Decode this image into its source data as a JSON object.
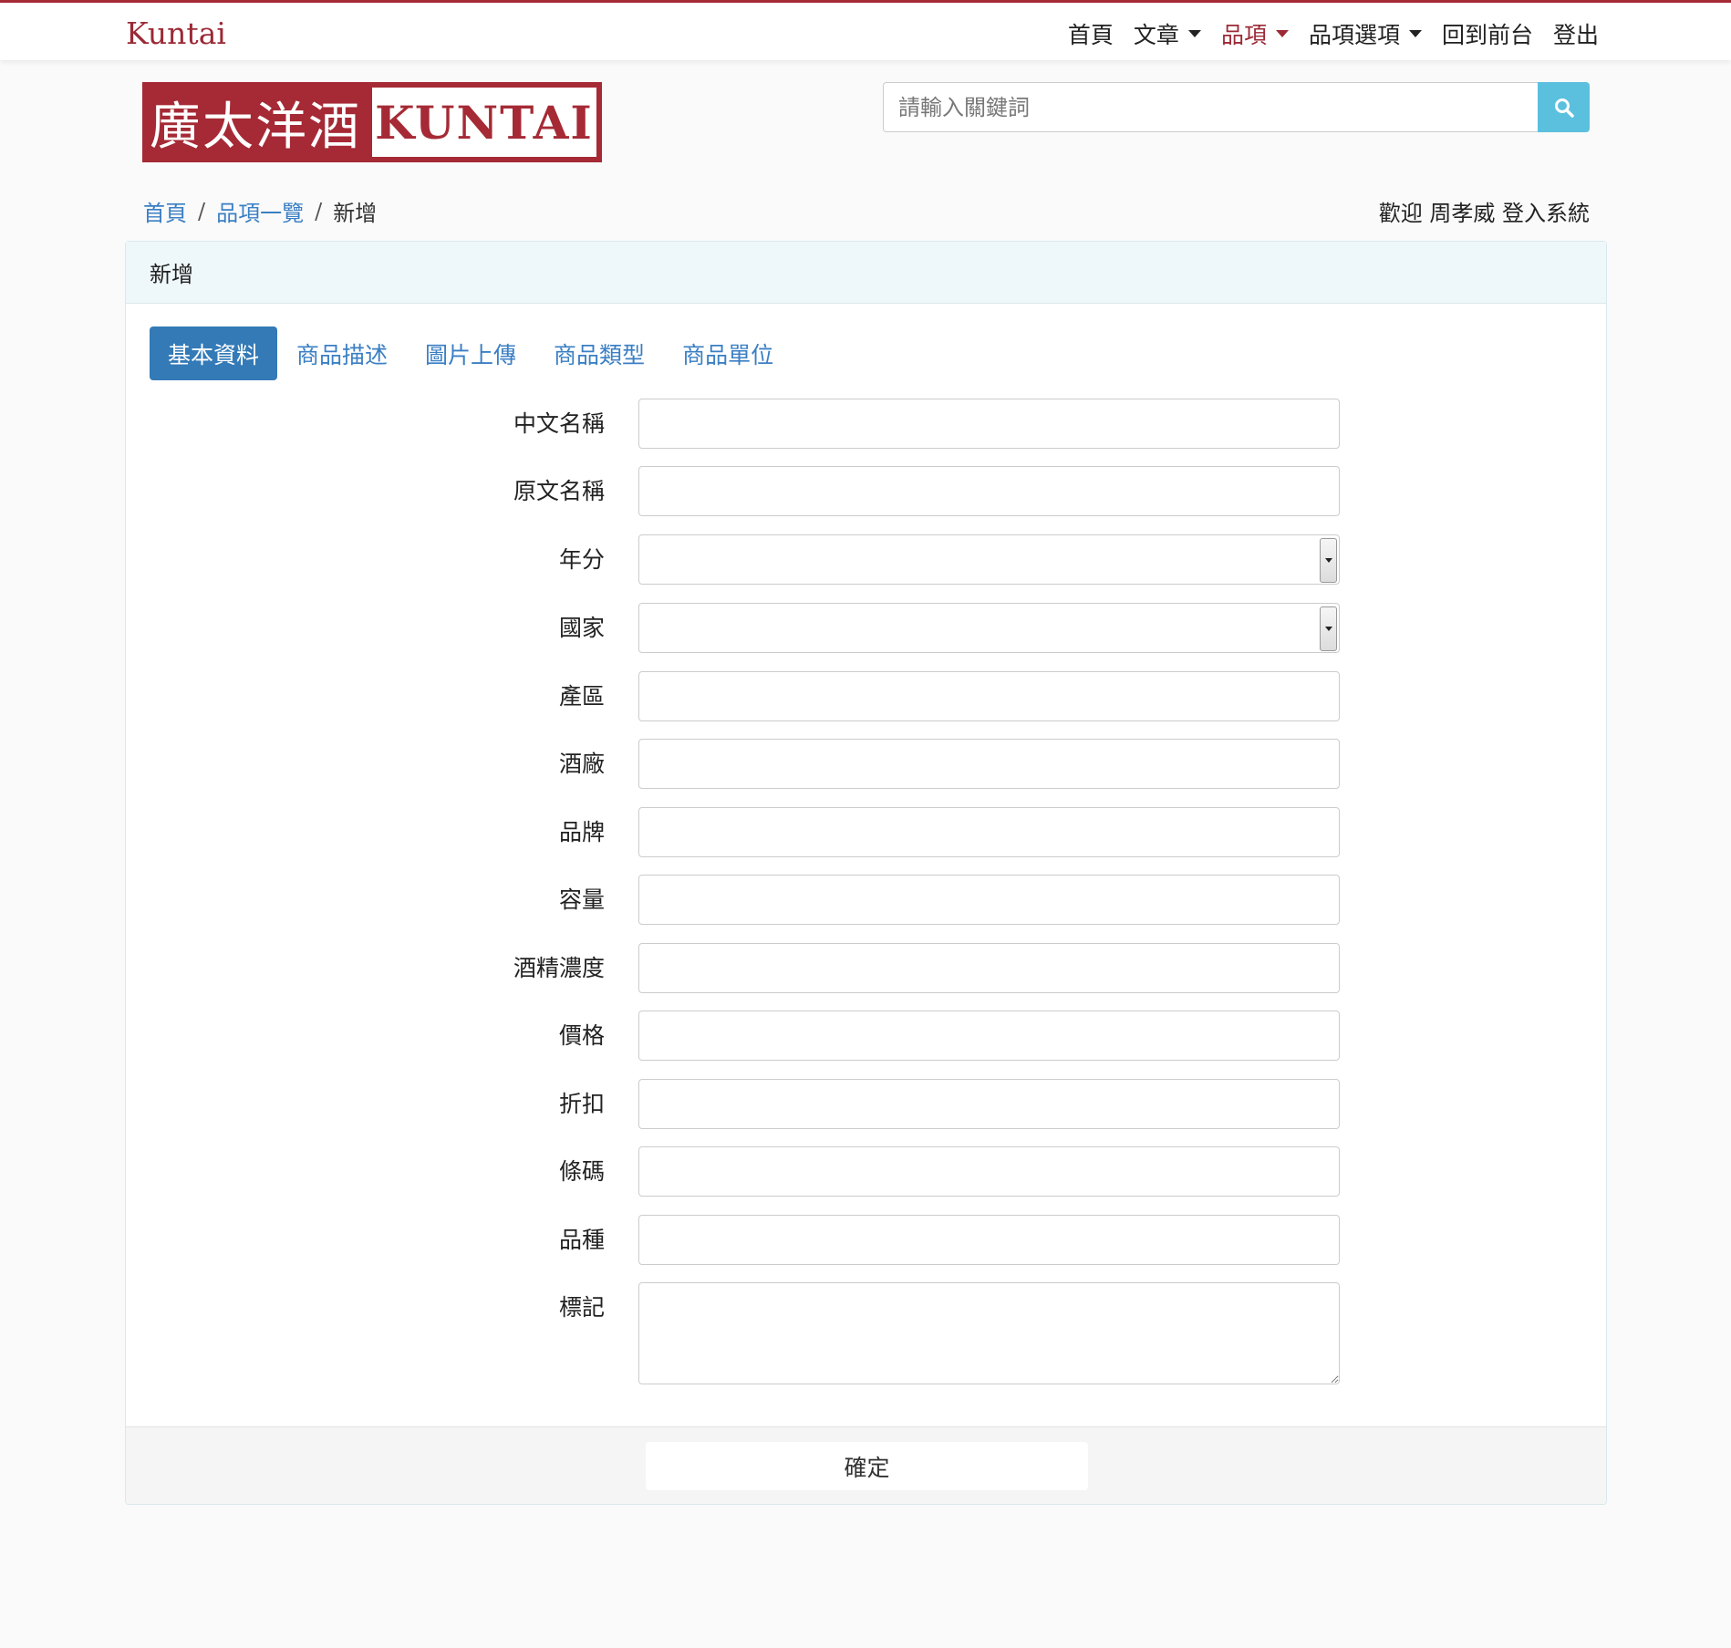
{
  "navbar": {
    "brand": "Kuntai",
    "items": [
      {
        "label": "首頁",
        "dropdown": false,
        "active": false
      },
      {
        "label": "文章",
        "dropdown": true,
        "active": false
      },
      {
        "label": "品項",
        "dropdown": true,
        "active": true
      },
      {
        "label": "品項選項",
        "dropdown": true,
        "active": false
      },
      {
        "label": "回到前台",
        "dropdown": false,
        "active": false
      },
      {
        "label": "登出",
        "dropdown": false,
        "active": false
      }
    ]
  },
  "logo": {
    "cn": "廣太洋酒",
    "en": "KUNTAI"
  },
  "search": {
    "placeholder": "請輸入關鍵詞",
    "icon": "search-icon"
  },
  "breadcrumb": {
    "home": "首頁",
    "list": "品項一覽",
    "separator": "/",
    "current": "新增"
  },
  "welcome": "歡迎 周孝威 登入系統",
  "panel": {
    "heading": "新增",
    "tabs": [
      "基本資料",
      "商品描述",
      "圖片上傳",
      "商品類型",
      "商品單位"
    ],
    "active_tab": 0,
    "fields": [
      {
        "label": "中文名稱",
        "type": "text",
        "value": ""
      },
      {
        "label": "原文名稱",
        "type": "text",
        "value": ""
      },
      {
        "label": "年分",
        "type": "select",
        "value": ""
      },
      {
        "label": "國家",
        "type": "select",
        "value": ""
      },
      {
        "label": "產區",
        "type": "text",
        "value": ""
      },
      {
        "label": "酒廠",
        "type": "text",
        "value": ""
      },
      {
        "label": "品牌",
        "type": "text",
        "value": ""
      },
      {
        "label": "容量",
        "type": "text",
        "value": ""
      },
      {
        "label": "酒精濃度",
        "type": "text",
        "value": ""
      },
      {
        "label": "價格",
        "type": "text",
        "value": ""
      },
      {
        "label": "折扣",
        "type": "text",
        "value": ""
      },
      {
        "label": "條碼",
        "type": "text",
        "value": ""
      },
      {
        "label": "品種",
        "type": "text",
        "value": ""
      },
      {
        "label": "標記",
        "type": "textarea",
        "value": ""
      }
    ],
    "submit_label": "確定"
  },
  "colors": {
    "brand": "#a52a35",
    "link": "#3b7fc4",
    "tab_active": "#337ab7",
    "search_button": "#5bc0de"
  }
}
